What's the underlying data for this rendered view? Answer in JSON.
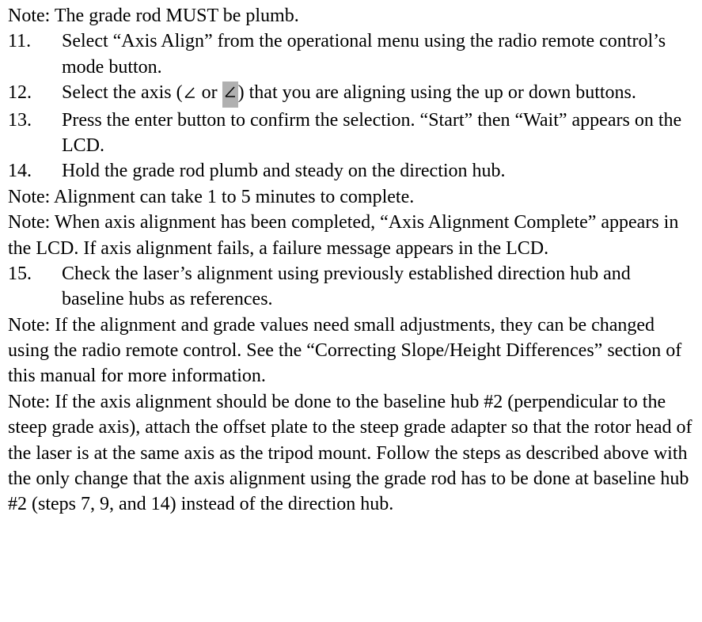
{
  "note_top": "Note: The grade rod MUST be plumb.",
  "items": {
    "11": {
      "num": "11.",
      "text": "Select “Axis Align” from the operational menu using the radio remote control’s mode button."
    },
    "12": {
      "num": "12.",
      "pre": "Select the axis (",
      "mid": " or ",
      "post": ") that you are aligning using the up or down buttons."
    },
    "13": {
      "num": "13.",
      "text": "Press the enter button to confirm the selection. “Start” then “Wait” appears on the LCD."
    },
    "14": {
      "num": "14.",
      "text": "Hold the grade rod plumb and steady on the direction hub."
    },
    "15": {
      "num": "15.",
      "text": "Check the laser’s alignment using previously established direction hub and baseline hubs as references."
    }
  },
  "note_align_time": "Note: Alignment can take 1 to 5 minutes to complete.",
  "note_align_complete": "Note: When axis alignment has been completed, “Axis Alignment Complete” appears in the LCD. If axis alignment fails, a failure message appears in the LCD.",
  "note_adjust": "Note: If the alignment and grade values need small adjustments, they can be changed using the radio remote control. See the “Correcting Slope/Height Differences” section of this manual for more information.",
  "note_baseline": "Note: If the axis alignment should be done to the baseline hub #2 (perpendicular to the steep grade axis), attach the offset plate to the steep grade adapter so that the rotor head of the laser is at the same axis as the tripod mount. Follow the steps as described above with the only change that the axis alignment using the grade rod has to be done at baseline hub #2 (steps 7, 9, and 14) instead of the direction hub."
}
